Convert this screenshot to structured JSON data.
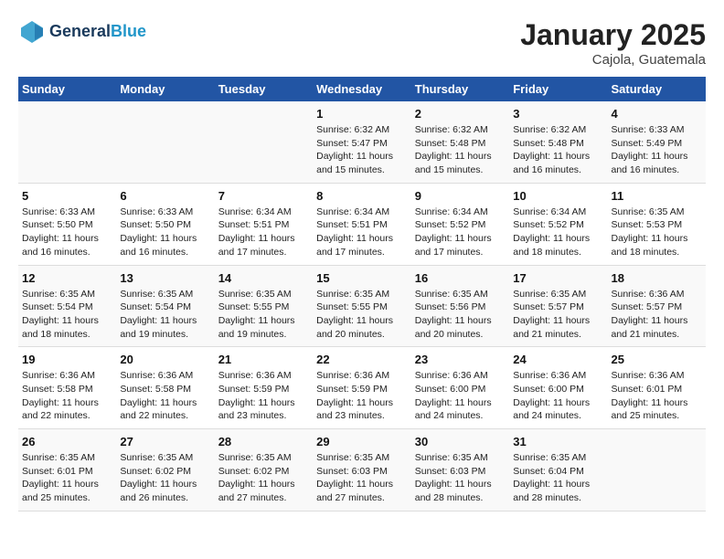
{
  "header": {
    "logo_line1": "General",
    "logo_line2": "Blue",
    "month": "January 2025",
    "location": "Cajola, Guatemala"
  },
  "days_of_week": [
    "Sunday",
    "Monday",
    "Tuesday",
    "Wednesday",
    "Thursday",
    "Friday",
    "Saturday"
  ],
  "weeks": [
    [
      {
        "day": "",
        "detail": ""
      },
      {
        "day": "",
        "detail": ""
      },
      {
        "day": "",
        "detail": ""
      },
      {
        "day": "1",
        "detail": "Sunrise: 6:32 AM\nSunset: 5:47 PM\nDaylight: 11 hours and 15 minutes."
      },
      {
        "day": "2",
        "detail": "Sunrise: 6:32 AM\nSunset: 5:48 PM\nDaylight: 11 hours and 15 minutes."
      },
      {
        "day": "3",
        "detail": "Sunrise: 6:32 AM\nSunset: 5:48 PM\nDaylight: 11 hours and 16 minutes."
      },
      {
        "day": "4",
        "detail": "Sunrise: 6:33 AM\nSunset: 5:49 PM\nDaylight: 11 hours and 16 minutes."
      }
    ],
    [
      {
        "day": "5",
        "detail": "Sunrise: 6:33 AM\nSunset: 5:50 PM\nDaylight: 11 hours and 16 minutes."
      },
      {
        "day": "6",
        "detail": "Sunrise: 6:33 AM\nSunset: 5:50 PM\nDaylight: 11 hours and 16 minutes."
      },
      {
        "day": "7",
        "detail": "Sunrise: 6:34 AM\nSunset: 5:51 PM\nDaylight: 11 hours and 17 minutes."
      },
      {
        "day": "8",
        "detail": "Sunrise: 6:34 AM\nSunset: 5:51 PM\nDaylight: 11 hours and 17 minutes."
      },
      {
        "day": "9",
        "detail": "Sunrise: 6:34 AM\nSunset: 5:52 PM\nDaylight: 11 hours and 17 minutes."
      },
      {
        "day": "10",
        "detail": "Sunrise: 6:34 AM\nSunset: 5:52 PM\nDaylight: 11 hours and 18 minutes."
      },
      {
        "day": "11",
        "detail": "Sunrise: 6:35 AM\nSunset: 5:53 PM\nDaylight: 11 hours and 18 minutes."
      }
    ],
    [
      {
        "day": "12",
        "detail": "Sunrise: 6:35 AM\nSunset: 5:54 PM\nDaylight: 11 hours and 18 minutes."
      },
      {
        "day": "13",
        "detail": "Sunrise: 6:35 AM\nSunset: 5:54 PM\nDaylight: 11 hours and 19 minutes."
      },
      {
        "day": "14",
        "detail": "Sunrise: 6:35 AM\nSunset: 5:55 PM\nDaylight: 11 hours and 19 minutes."
      },
      {
        "day": "15",
        "detail": "Sunrise: 6:35 AM\nSunset: 5:55 PM\nDaylight: 11 hours and 20 minutes."
      },
      {
        "day": "16",
        "detail": "Sunrise: 6:35 AM\nSunset: 5:56 PM\nDaylight: 11 hours and 20 minutes."
      },
      {
        "day": "17",
        "detail": "Sunrise: 6:35 AM\nSunset: 5:57 PM\nDaylight: 11 hours and 21 minutes."
      },
      {
        "day": "18",
        "detail": "Sunrise: 6:36 AM\nSunset: 5:57 PM\nDaylight: 11 hours and 21 minutes."
      }
    ],
    [
      {
        "day": "19",
        "detail": "Sunrise: 6:36 AM\nSunset: 5:58 PM\nDaylight: 11 hours and 22 minutes."
      },
      {
        "day": "20",
        "detail": "Sunrise: 6:36 AM\nSunset: 5:58 PM\nDaylight: 11 hours and 22 minutes."
      },
      {
        "day": "21",
        "detail": "Sunrise: 6:36 AM\nSunset: 5:59 PM\nDaylight: 11 hours and 23 minutes."
      },
      {
        "day": "22",
        "detail": "Sunrise: 6:36 AM\nSunset: 5:59 PM\nDaylight: 11 hours and 23 minutes."
      },
      {
        "day": "23",
        "detail": "Sunrise: 6:36 AM\nSunset: 6:00 PM\nDaylight: 11 hours and 24 minutes."
      },
      {
        "day": "24",
        "detail": "Sunrise: 6:36 AM\nSunset: 6:00 PM\nDaylight: 11 hours and 24 minutes."
      },
      {
        "day": "25",
        "detail": "Sunrise: 6:36 AM\nSunset: 6:01 PM\nDaylight: 11 hours and 25 minutes."
      }
    ],
    [
      {
        "day": "26",
        "detail": "Sunrise: 6:35 AM\nSunset: 6:01 PM\nDaylight: 11 hours and 25 minutes."
      },
      {
        "day": "27",
        "detail": "Sunrise: 6:35 AM\nSunset: 6:02 PM\nDaylight: 11 hours and 26 minutes."
      },
      {
        "day": "28",
        "detail": "Sunrise: 6:35 AM\nSunset: 6:02 PM\nDaylight: 11 hours and 27 minutes."
      },
      {
        "day": "29",
        "detail": "Sunrise: 6:35 AM\nSunset: 6:03 PM\nDaylight: 11 hours and 27 minutes."
      },
      {
        "day": "30",
        "detail": "Sunrise: 6:35 AM\nSunset: 6:03 PM\nDaylight: 11 hours and 28 minutes."
      },
      {
        "day": "31",
        "detail": "Sunrise: 6:35 AM\nSunset: 6:04 PM\nDaylight: 11 hours and 28 minutes."
      },
      {
        "day": "",
        "detail": ""
      }
    ]
  ]
}
